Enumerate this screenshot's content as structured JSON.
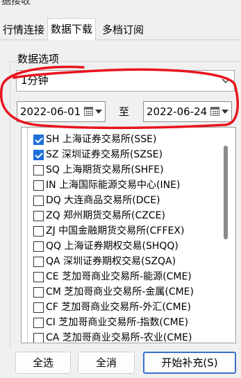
{
  "window": {
    "title": "据接收"
  },
  "tabs": [
    {
      "label": "行情连接"
    },
    {
      "label": "数据下载"
    },
    {
      "label": "多档订阅"
    }
  ],
  "group": {
    "label": "数据选项"
  },
  "period_select": {
    "value": "1分钟"
  },
  "date_range": {
    "start": "2022-06-01",
    "separator": "至",
    "end": "2022-06-24"
  },
  "exchanges": [
    {
      "label": "SH 上海证券交易所(SSE)",
      "checked": true
    },
    {
      "label": "SZ 深圳证券交易所(SZSE)",
      "checked": true
    },
    {
      "label": "SQ 上海期货交易所(SHFE)",
      "checked": false
    },
    {
      "label": "IN 上海国际能源交易中心(INE)",
      "checked": false
    },
    {
      "label": "DQ 大连商品交易所(DCE)",
      "checked": false
    },
    {
      "label": "ZQ 郑州期货交易所(CZCE)",
      "checked": false
    },
    {
      "label": "ZJ 中国金融期货交易所(CFFEX)",
      "checked": false
    },
    {
      "label": "QQ 上海证券期权交易(SHQQ)",
      "checked": false
    },
    {
      "label": "QA 深圳证券期权交易(SZQA)",
      "checked": false
    },
    {
      "label": "CE 芝加哥商业交易所-能源(CME)",
      "checked": false
    },
    {
      "label": "CM 芝加哥商业交易所-金属(CME)",
      "checked": false
    },
    {
      "label": "CF 芝加哥商业交易所-外汇(CME)",
      "checked": false
    },
    {
      "label": "CI 芝加哥商业交易所-指数(CME)",
      "checked": false
    },
    {
      "label": "CA 芝加哥商业交易所-农业(CME)",
      "checked": false
    }
  ],
  "buttons": {
    "select_all": "全选",
    "cancel_all": "全消",
    "start": "开始补充(S)"
  },
  "colors": {
    "annotation": "#e8141e",
    "checkbox_checked": "#1e6fd9",
    "primary_border": "#3a6fd0"
  }
}
